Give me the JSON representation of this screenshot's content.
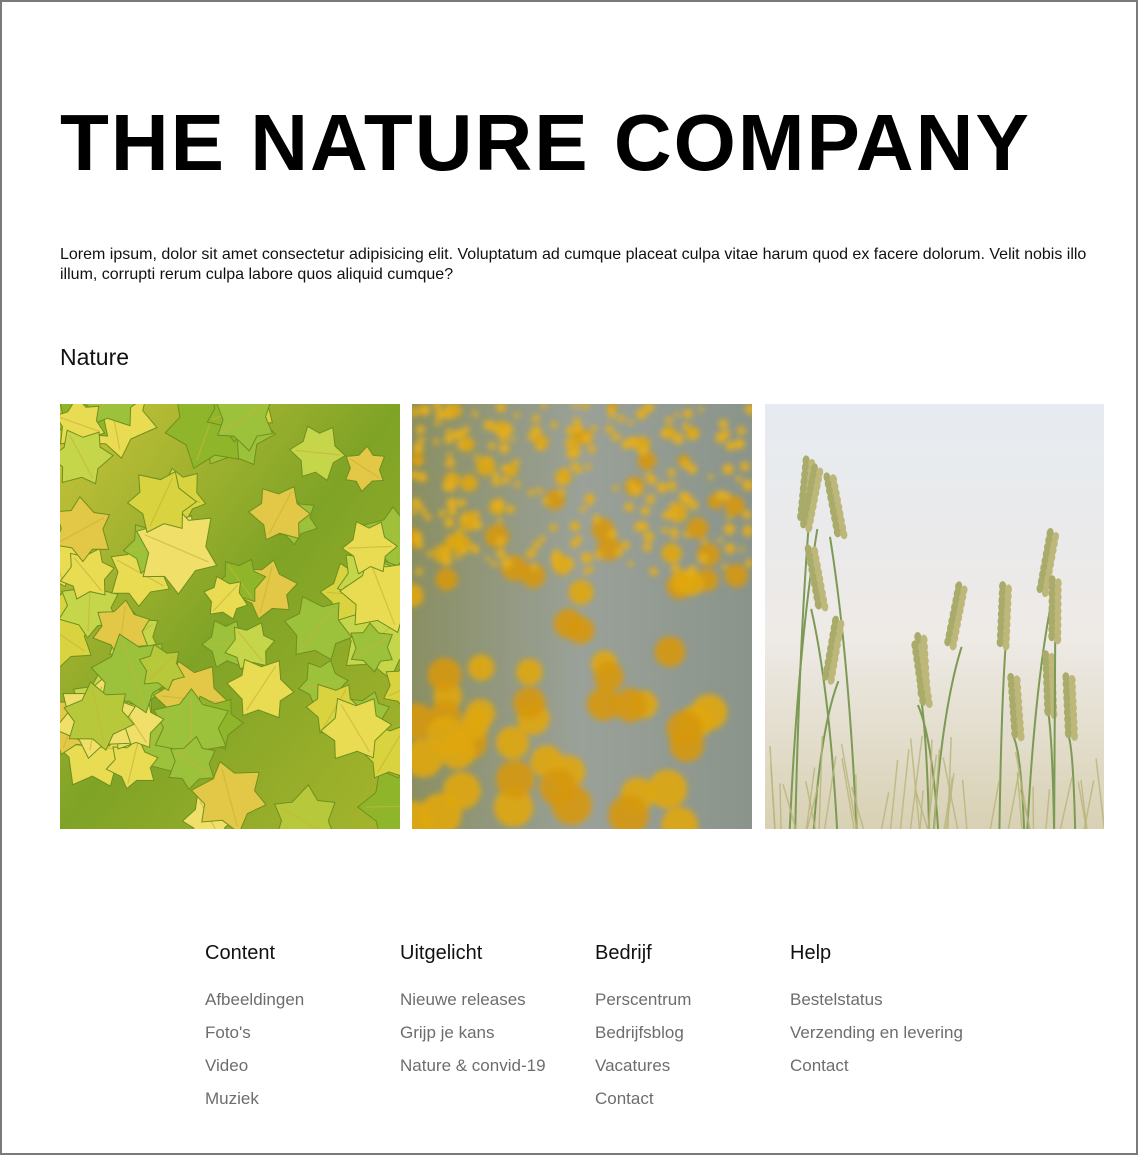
{
  "hero": {
    "title": "THE NATURE COMPANY",
    "intro": "Lorem ipsum, dolor sit amet consectetur adipisicing elit. Voluptatum ad cumque placeat culpa vitae harum quod ex facere dolorum. Velit nobis illo illum, corrupti rerum culpa labore quos aliquid cumque?"
  },
  "section": {
    "heading": "Nature"
  },
  "gallery": {
    "photos": [
      {
        "subject": "yellow-green leaves"
      },
      {
        "subject": "yellow flower field"
      },
      {
        "subject": "wheat stalks"
      }
    ]
  },
  "footer": {
    "columns": [
      {
        "heading": "Content",
        "links": [
          "Afbeeldingen",
          "Foto's",
          "Video",
          "Muziek"
        ]
      },
      {
        "heading": "Uitgelicht",
        "links": [
          "Nieuwe releases",
          "Grijp je kans",
          "Nature & convid-19"
        ]
      },
      {
        "heading": "Bedrijf",
        "links": [
          "Perscentrum",
          "Bedrijfsblog",
          "Vacatures",
          "Contact"
        ]
      },
      {
        "heading": "Help",
        "links": [
          "Bestelstatus",
          "Verzending en levering",
          "Contact"
        ]
      }
    ]
  },
  "colors": {
    "text": "#111111",
    "link": "#6d6d6d",
    "leaf_yellow": "#e8d84a",
    "leaf_green": "#8fb52a",
    "flower_orange": "#e0a712",
    "stem_gray": "#8e9a8c",
    "sky": "#e8edf2",
    "wheat": "#b9b57a"
  }
}
